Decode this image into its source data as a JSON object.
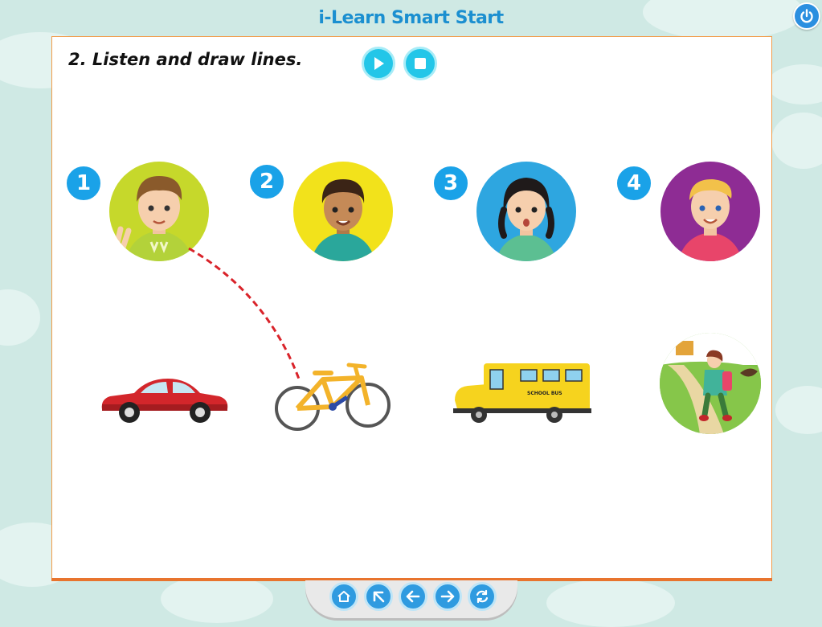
{
  "app": {
    "title": "i-Learn Smart Start"
  },
  "exercise": {
    "instruction": "2. Listen and draw lines.",
    "controls": {
      "play_icon": "play-icon",
      "stop_icon": "stop-icon"
    },
    "people": [
      {
        "number": "1",
        "color": "#c6d82b"
      },
      {
        "number": "2",
        "color": "#f2e21b"
      },
      {
        "number": "3",
        "color": "#2ea6e0"
      },
      {
        "number": "4",
        "color": "#8e2c94"
      }
    ],
    "items": [
      {
        "name": "car"
      },
      {
        "name": "bicycle"
      },
      {
        "name": "school bus",
        "label": "SCHOOL BUS"
      },
      {
        "name": "walking"
      }
    ],
    "lines_drawn": [
      {
        "from_person": 1,
        "to_item": "bicycle"
      }
    ]
  },
  "nav": {
    "buttons": [
      "home-icon",
      "arrow-up-left-icon",
      "arrow-left-icon",
      "arrow-right-icon",
      "refresh-icon"
    ]
  },
  "colors": {
    "accent": "#1aa2e8",
    "panel_border": "#f29b48",
    "line": "#d9232a",
    "title": "#1b8fd0"
  }
}
